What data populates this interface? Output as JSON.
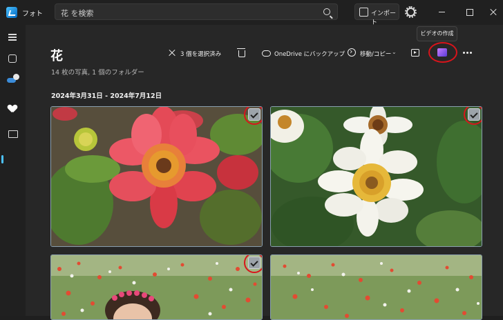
{
  "app": {
    "name": "フォト"
  },
  "search": {
    "query": "花 を検索"
  },
  "header": {
    "import_label": "インポート"
  },
  "page": {
    "title": "花",
    "subtitle": "14 枚の写真, 1 個のフォルダー",
    "date_range": "2024年3月31日 - 2024年7月12日"
  },
  "commands": {
    "selected": "3 個を選択済み",
    "onedrive": "OneDrive にバックアップ",
    "move_copy": "移動/コピー",
    "tooltip": "ビデオの作成"
  },
  "photos": [
    {
      "subject": "pink-zinnia",
      "selected": true
    },
    {
      "subject": "white-zinnia",
      "selected": false
    },
    {
      "subject": "flower-field-girl",
      "selected": true
    },
    {
      "subject": "flower-field",
      "selected": false
    }
  ],
  "colors": {
    "accent": "#4cc2ff",
    "annotation_red": "#d9141b",
    "background": "#272727"
  }
}
